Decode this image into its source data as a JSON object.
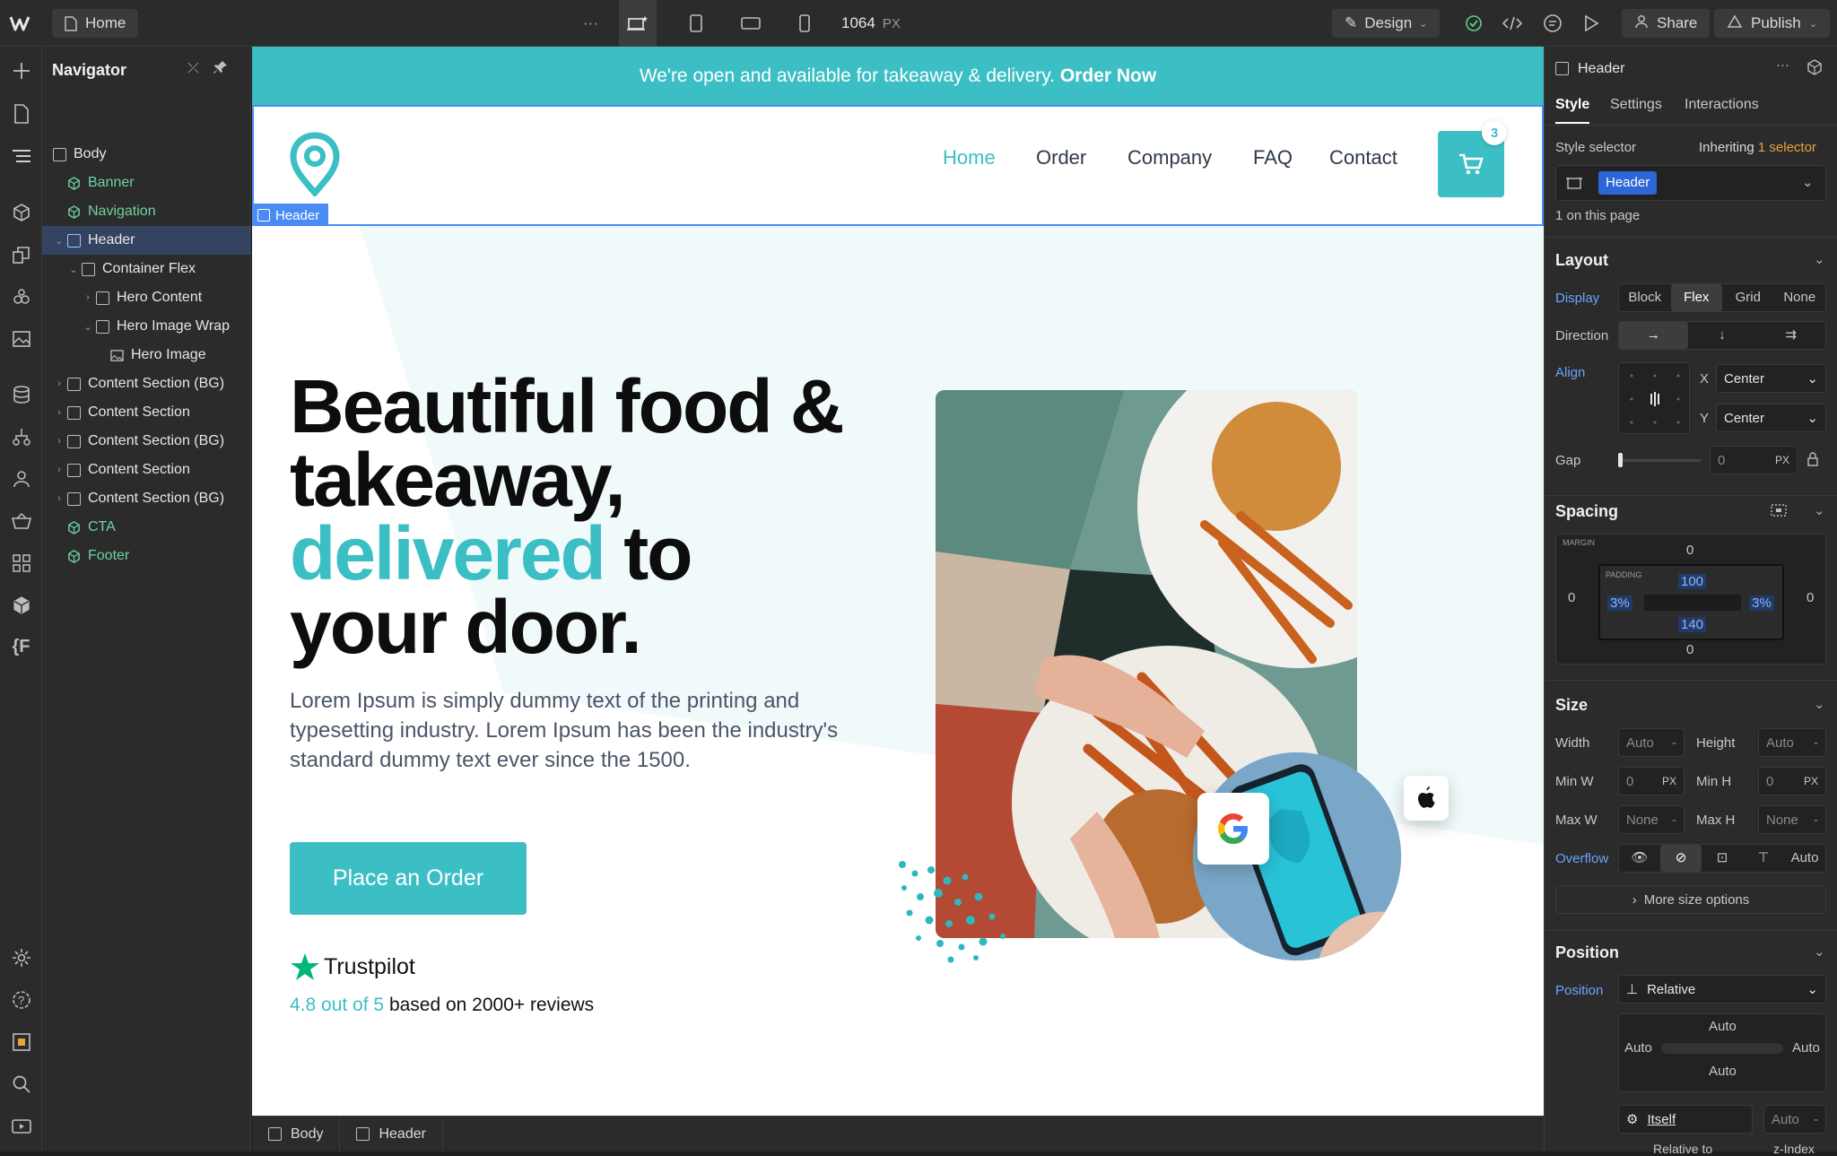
{
  "topbar": {
    "page_name": "Home",
    "more": "···",
    "width_value": "1064",
    "width_unit": "PX",
    "mode_label": "Design",
    "share_label": "Share",
    "publish_label": "Publish"
  },
  "navigator": {
    "title": "Navigator",
    "items": [
      {
        "label": "Body"
      },
      {
        "label": "Banner"
      },
      {
        "label": "Navigation"
      },
      {
        "label": "Header"
      },
      {
        "label": "Container Flex"
      },
      {
        "label": "Hero Content"
      },
      {
        "label": "Hero Image Wrap"
      },
      {
        "label": "Hero Image"
      },
      {
        "label": "Content Section (BG)"
      },
      {
        "label": "Content Section"
      },
      {
        "label": "Content Section (BG)"
      },
      {
        "label": "Content Section"
      },
      {
        "label": "Content Section (BG)"
      },
      {
        "label": "CTA"
      },
      {
        "label": "Footer"
      }
    ]
  },
  "site": {
    "banner_text": "We're open and available for takeaway & delivery.",
    "banner_link": "Order Now",
    "nav": [
      "Home",
      "Order",
      "Company",
      "FAQ",
      "Contact"
    ],
    "cart_count": "3",
    "selected_tag": "Header",
    "hero_line1": "Beautiful food &",
    "hero_line2": "takeaway,",
    "hero_teal": "delivered",
    "hero_to": " to",
    "hero_line4": "your door.",
    "hero_para": "Lorem Ipsum is simply dummy text of the printing and typesetting industry. Lorem Ipsum has been the industry's standard dummy text ever since the 1500.",
    "cta_label": "Place an Order",
    "trustpilot": "Trustpilot",
    "rating": "4.8 out of 5",
    "reviews": "based on 2000+ reviews",
    "accent_color": "#3cbfc4"
  },
  "breadcrumb": [
    "Body",
    "Header"
  ],
  "panel": {
    "element": "Header",
    "tabs": [
      "Style",
      "Settings",
      "Interactions"
    ],
    "style_selector_label": "Style selector",
    "inheriting": "Inheriting",
    "inheriting_count": "1 selector",
    "selector_value": "Header",
    "on_page": "1 on this page",
    "layout": {
      "title": "Layout",
      "display_label": "Display",
      "display_options": [
        "Block",
        "Flex",
        "Grid",
        "None"
      ],
      "display_active": "Flex",
      "direction_label": "Direction",
      "align_label": "Align",
      "x_label": "X",
      "x_value": "Center",
      "y_label": "Y",
      "y_value": "Center",
      "gap_label": "Gap",
      "gap_value": "0",
      "gap_unit": "PX"
    },
    "spacing": {
      "title": "Spacing",
      "margin_label": "MARGIN",
      "margin_top": "0",
      "margin_left": "0",
      "margin_right": "0",
      "margin_bottom": "0",
      "padding_label": "PADDING",
      "padding_top": "100",
      "padding_left": "3%",
      "padding_right": "3%",
      "padding_bottom": "140"
    },
    "size": {
      "title": "Size",
      "width_label": "Width",
      "width_value": "Auto",
      "height_label": "Height",
      "height_value": "Auto",
      "minw_label": "Min W",
      "minw_value": "0",
      "minh_label": "Min H",
      "minh_value": "0",
      "maxw_label": "Max W",
      "maxw_value": "None",
      "maxh_label": "Max H",
      "maxh_value": "None",
      "unit": "PX",
      "overflow_label": "Overflow",
      "overflow_auto": "Auto",
      "more_label": "More size options"
    },
    "position": {
      "title": "Position",
      "position_label": "Position",
      "position_value": "Relative",
      "auto": "Auto",
      "itself": "Itself",
      "zindex_value": "Auto",
      "relative_to": "Relative to",
      "zindex_label": "z-Index"
    }
  }
}
